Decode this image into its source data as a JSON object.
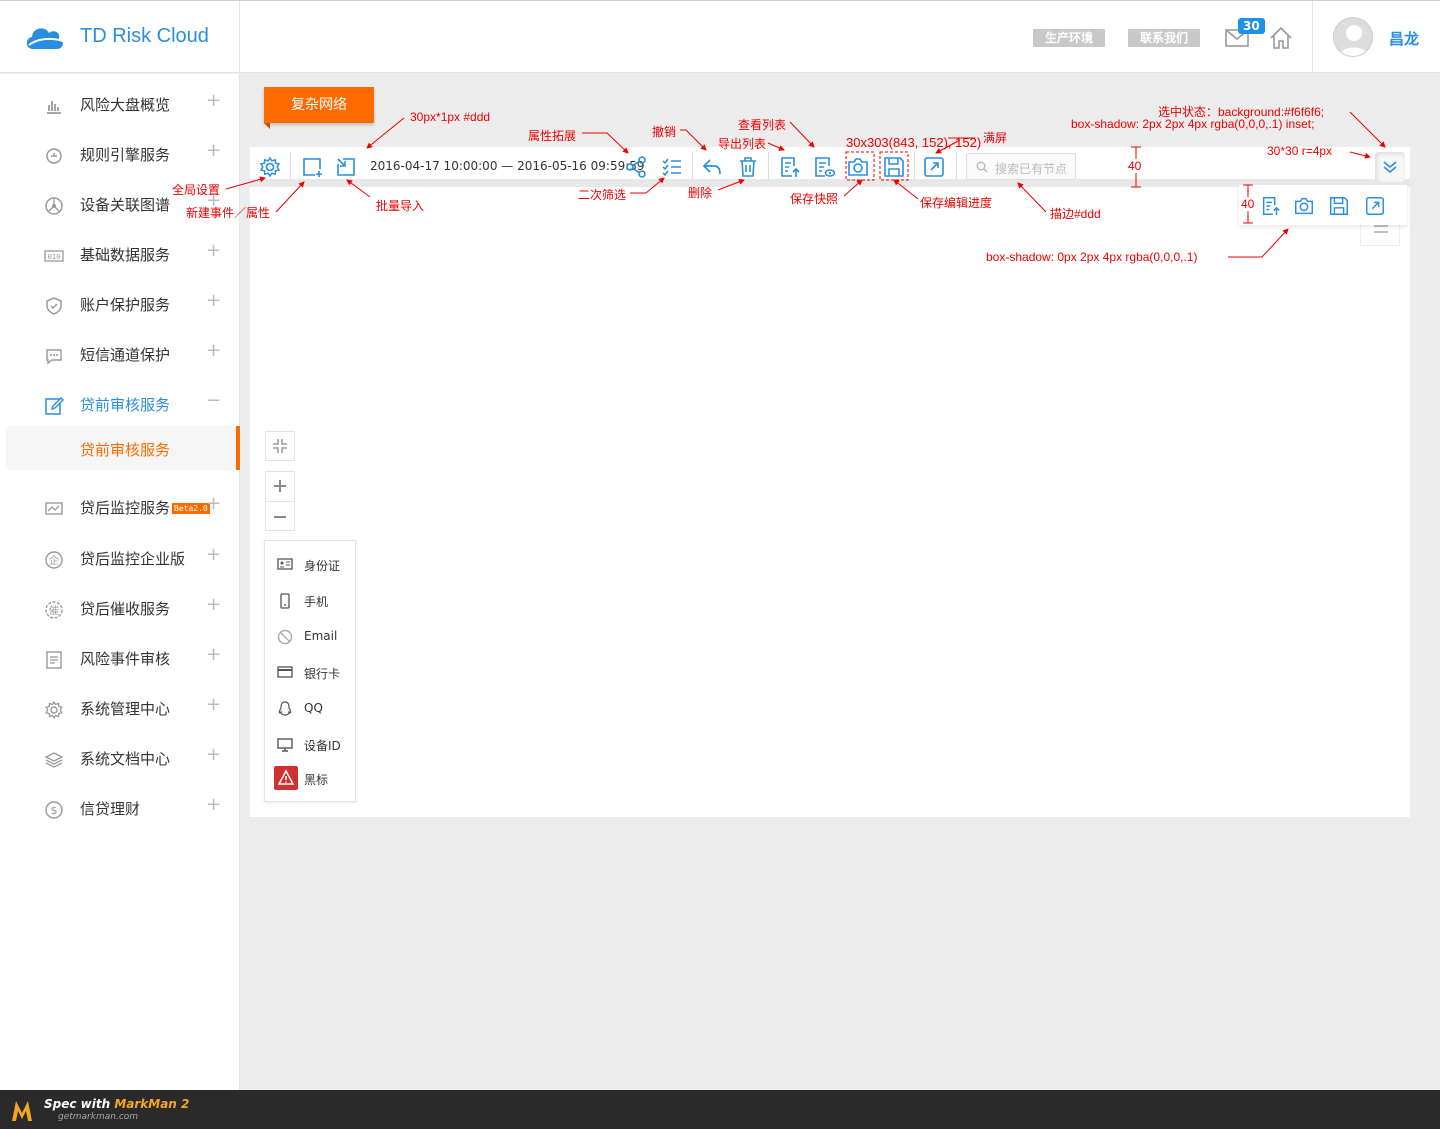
{
  "header": {
    "app_title": "TD Risk Cloud",
    "env_button": "生产环境",
    "contact_button": "联系我们",
    "mail_count": "30",
    "user_name": "昌龙"
  },
  "sidebar": {
    "items": [
      {
        "label": "风险大盘概览",
        "icon": "bar-chart-icon"
      },
      {
        "label": "规则引擎服务",
        "icon": "rule-engine-icon"
      },
      {
        "label": "设备关联图谱",
        "icon": "graph-icon"
      },
      {
        "label": "基础数据服务",
        "icon": "data-icon"
      },
      {
        "label": "账户保护服务",
        "icon": "shield-icon"
      },
      {
        "label": "短信通道保护",
        "icon": "sms-icon"
      },
      {
        "label": "贷前审核服务",
        "icon": "edit-icon"
      },
      {
        "label": "贷后监控服务",
        "icon": "monitor-icon",
        "badge": "Beta2.0"
      },
      {
        "label": "贷后监控企业版",
        "icon": "enterprise-icon"
      },
      {
        "label": "贷后催收服务",
        "icon": "collection-icon"
      },
      {
        "label": "风险事件审核",
        "icon": "audit-icon"
      },
      {
        "label": "系统管理中心",
        "icon": "gear-icon"
      },
      {
        "label": "系统文档中心",
        "icon": "layers-icon"
      },
      {
        "label": "信贷理财",
        "icon": "dollar-icon"
      }
    ],
    "sub_item": "贷前审核服务"
  },
  "main": {
    "tab": "复杂网络",
    "date_range": "2016-04-17 10:00:00 — 2016-05-16 09:59:59",
    "search_placeholder": "搜索已有节点"
  },
  "legend": [
    {
      "label": "身份证",
      "icon": "id-card-icon"
    },
    {
      "label": "手机",
      "icon": "phone-icon"
    },
    {
      "label": "Email",
      "icon": "email-icon"
    },
    {
      "label": "银行卡",
      "icon": "bank-card-icon"
    },
    {
      "label": "QQ",
      "icon": "qq-icon"
    },
    {
      "label": "设备ID",
      "icon": "monitor-icon"
    },
    {
      "label": "黑标",
      "icon": "warning-icon"
    }
  ],
  "annotations": {
    "a1": "30px*1px #ddd",
    "a2": "属性拓展",
    "a3": "撤销",
    "a4": "查看列表",
    "a5": "导出列表",
    "a6": "30x303(843, 152), 152)",
    "a7": "满屏",
    "a8": "选中状态：background:#f6f6f6;",
    "a9": "box-shadow: 2px 2px 4px rgba(0,0,0,.1) inset;",
    "a10": "30*30 r=4px",
    "a11": "全局设置",
    "a12": "新建事件／属性",
    "a13": "批量导入",
    "a14": "二次筛选",
    "a15": "删除",
    "a16": "保存快照",
    "a17": "保存编辑进度",
    "a18": "描边#ddd",
    "a19": "40",
    "a20": "40",
    "a21": "box-shadow: 0px 2px 4px rgba(0,0,0,.1)"
  },
  "footer": {
    "spec_prefix": "Spec with ",
    "spec_brand": "MarkMan 2",
    "url": "getmarkman.com"
  },
  "colors": {
    "accent": "#ff6a00",
    "brand_blue": "#2a8ee0",
    "annotation": "#e00000"
  }
}
